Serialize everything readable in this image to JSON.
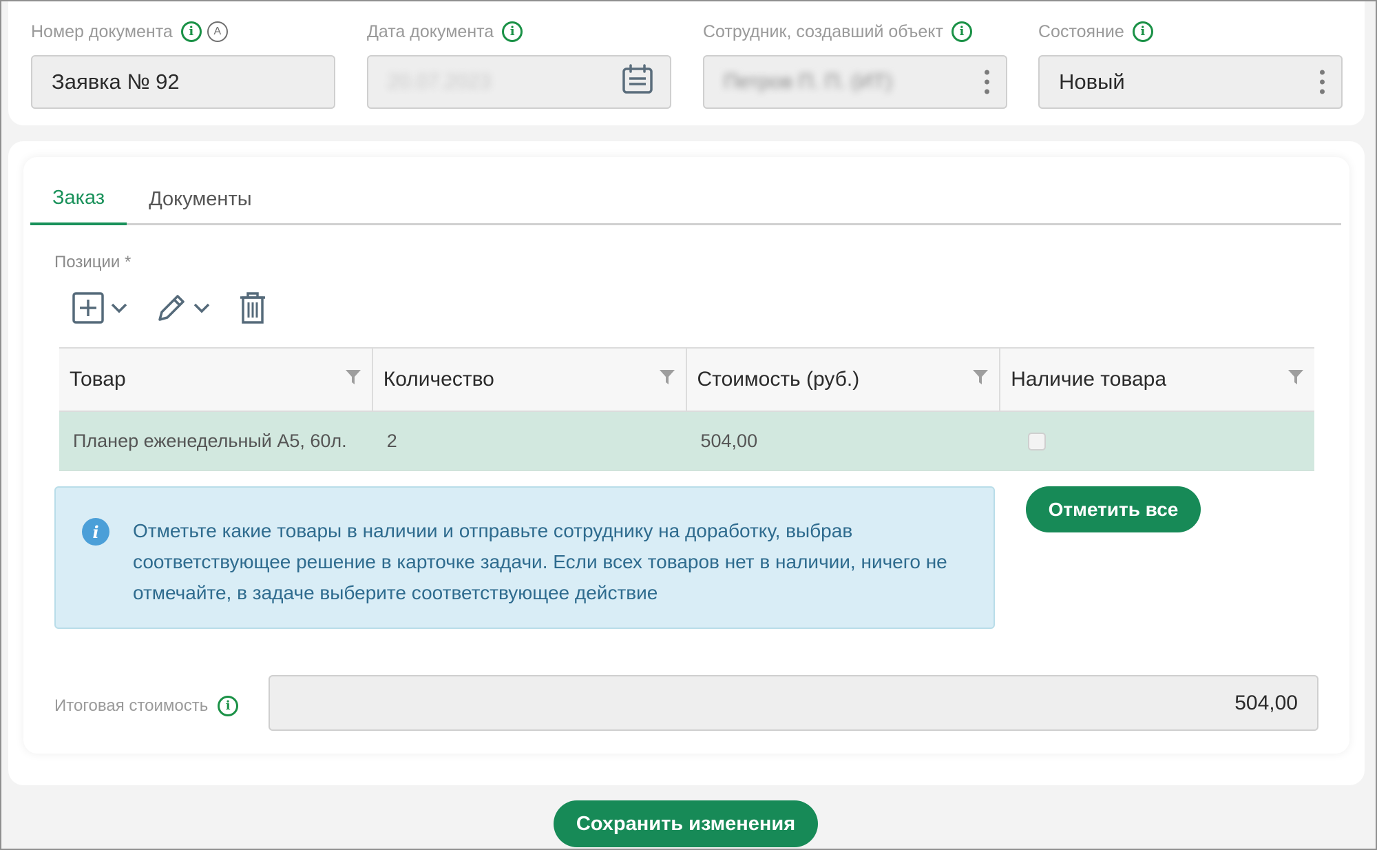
{
  "header": {
    "doc_number": {
      "label": "Номер документа",
      "value": "Заявка № 92",
      "auto_icon": "A"
    },
    "doc_date": {
      "label": "Дата документа",
      "value": "20.07.2023"
    },
    "creator": {
      "label": "Сотрудник, создавший объект",
      "value": "Петров П. П. (ИТ)"
    },
    "status": {
      "label": "Состояние",
      "value": "Новый"
    }
  },
  "tabs": [
    {
      "label": "Заказ",
      "active": true
    },
    {
      "label": "Документы",
      "active": false
    }
  ],
  "positions": {
    "label": "Позиции *",
    "toolbar": [
      "add-icon",
      "edit-icon",
      "delete-icon"
    ],
    "columns": [
      "Товар",
      "Количество",
      "Стоимость (руб.)",
      "Наличие товара"
    ],
    "rows": [
      {
        "item": "Планер еженедельный А5, 60л.",
        "quantity": "2",
        "cost": "504,00",
        "in_stock": false
      }
    ]
  },
  "info_message": "Отметьте какие товары в наличии и отправьте сотруднику на доработку, выбрав соответствующее решение в карточке задачи. Если всех товаров нет в наличии, ничего не отмечайте, в задаче выберите соответствующее действие",
  "mark_all_label": "Отметить все",
  "total": {
    "label": "Итоговая стоимость",
    "value": "504,00"
  },
  "save_label": "Сохранить изменения",
  "colors": {
    "accent": "#178a57",
    "info_bg": "#d9edf6",
    "selected_row": "#d2e8df"
  }
}
